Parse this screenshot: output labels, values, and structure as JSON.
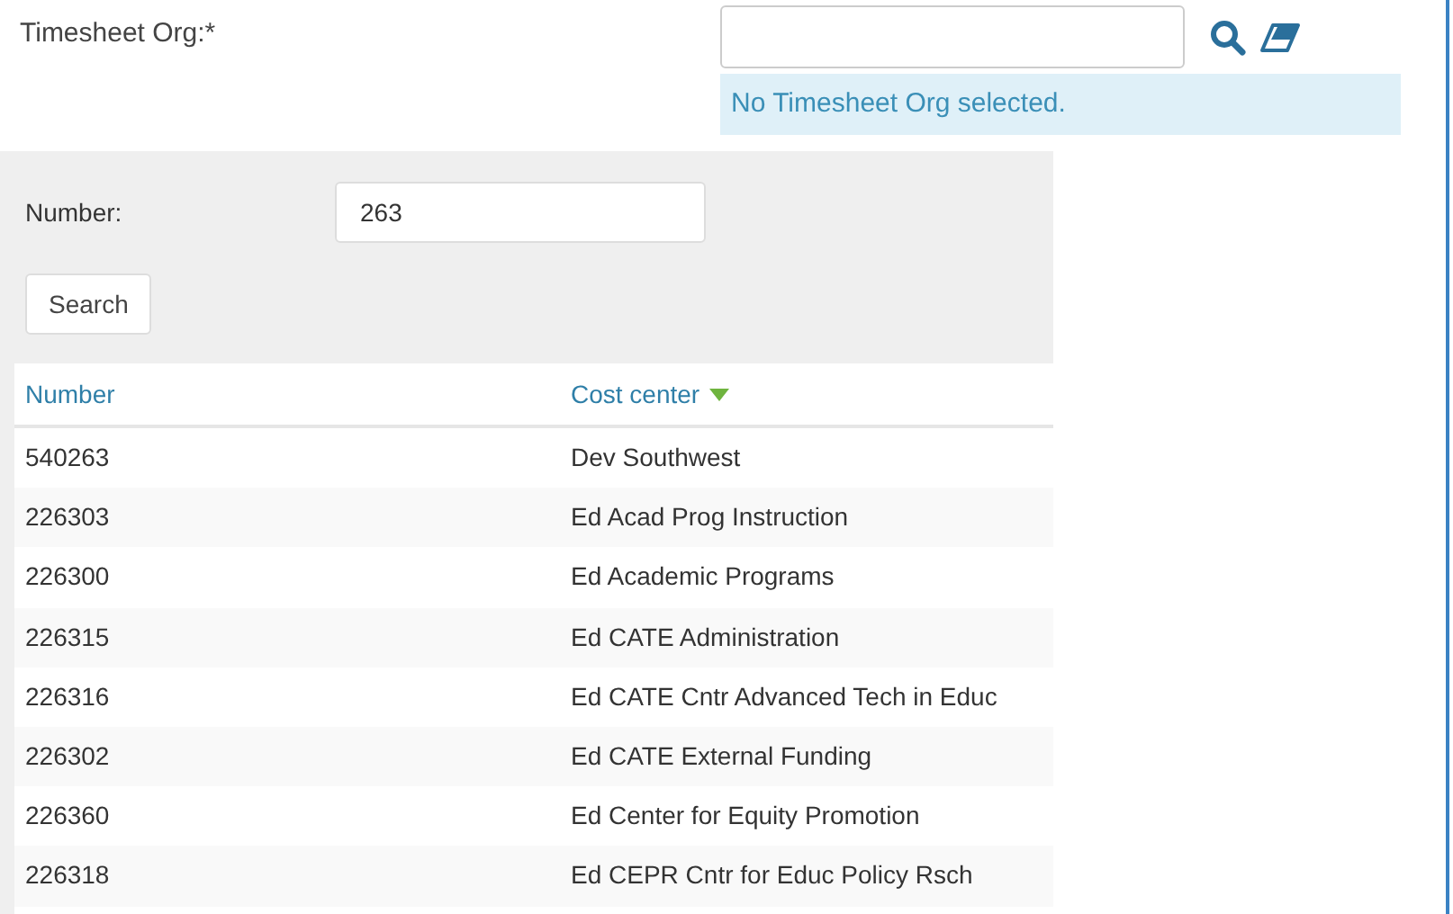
{
  "timesheet_org": {
    "label": "Timesheet Org:*",
    "message": "No Timesheet Org selected."
  },
  "search_panel": {
    "number_label": "Number:",
    "number_value": "263",
    "search_button": "Search"
  },
  "table": {
    "columns": [
      {
        "label": "Number",
        "sorted": false
      },
      {
        "label": "Cost center",
        "sorted": true
      }
    ],
    "rows": [
      [
        "540263",
        "Dev Southwest"
      ],
      [
        "226303",
        "Ed Acad Prog Instruction"
      ],
      [
        "226300",
        "Ed Academic Programs"
      ],
      [
        "226315",
        "Ed CATE Administration"
      ],
      [
        "226316",
        "Ed CATE Cntr Advanced Tech in Educ"
      ],
      [
        "226302",
        "Ed CATE External Funding"
      ],
      [
        "226360",
        "Ed Center for Equity Promotion"
      ],
      [
        "226318",
        "Ed CEPR Cntr for Educ Policy Rsch"
      ]
    ]
  }
}
